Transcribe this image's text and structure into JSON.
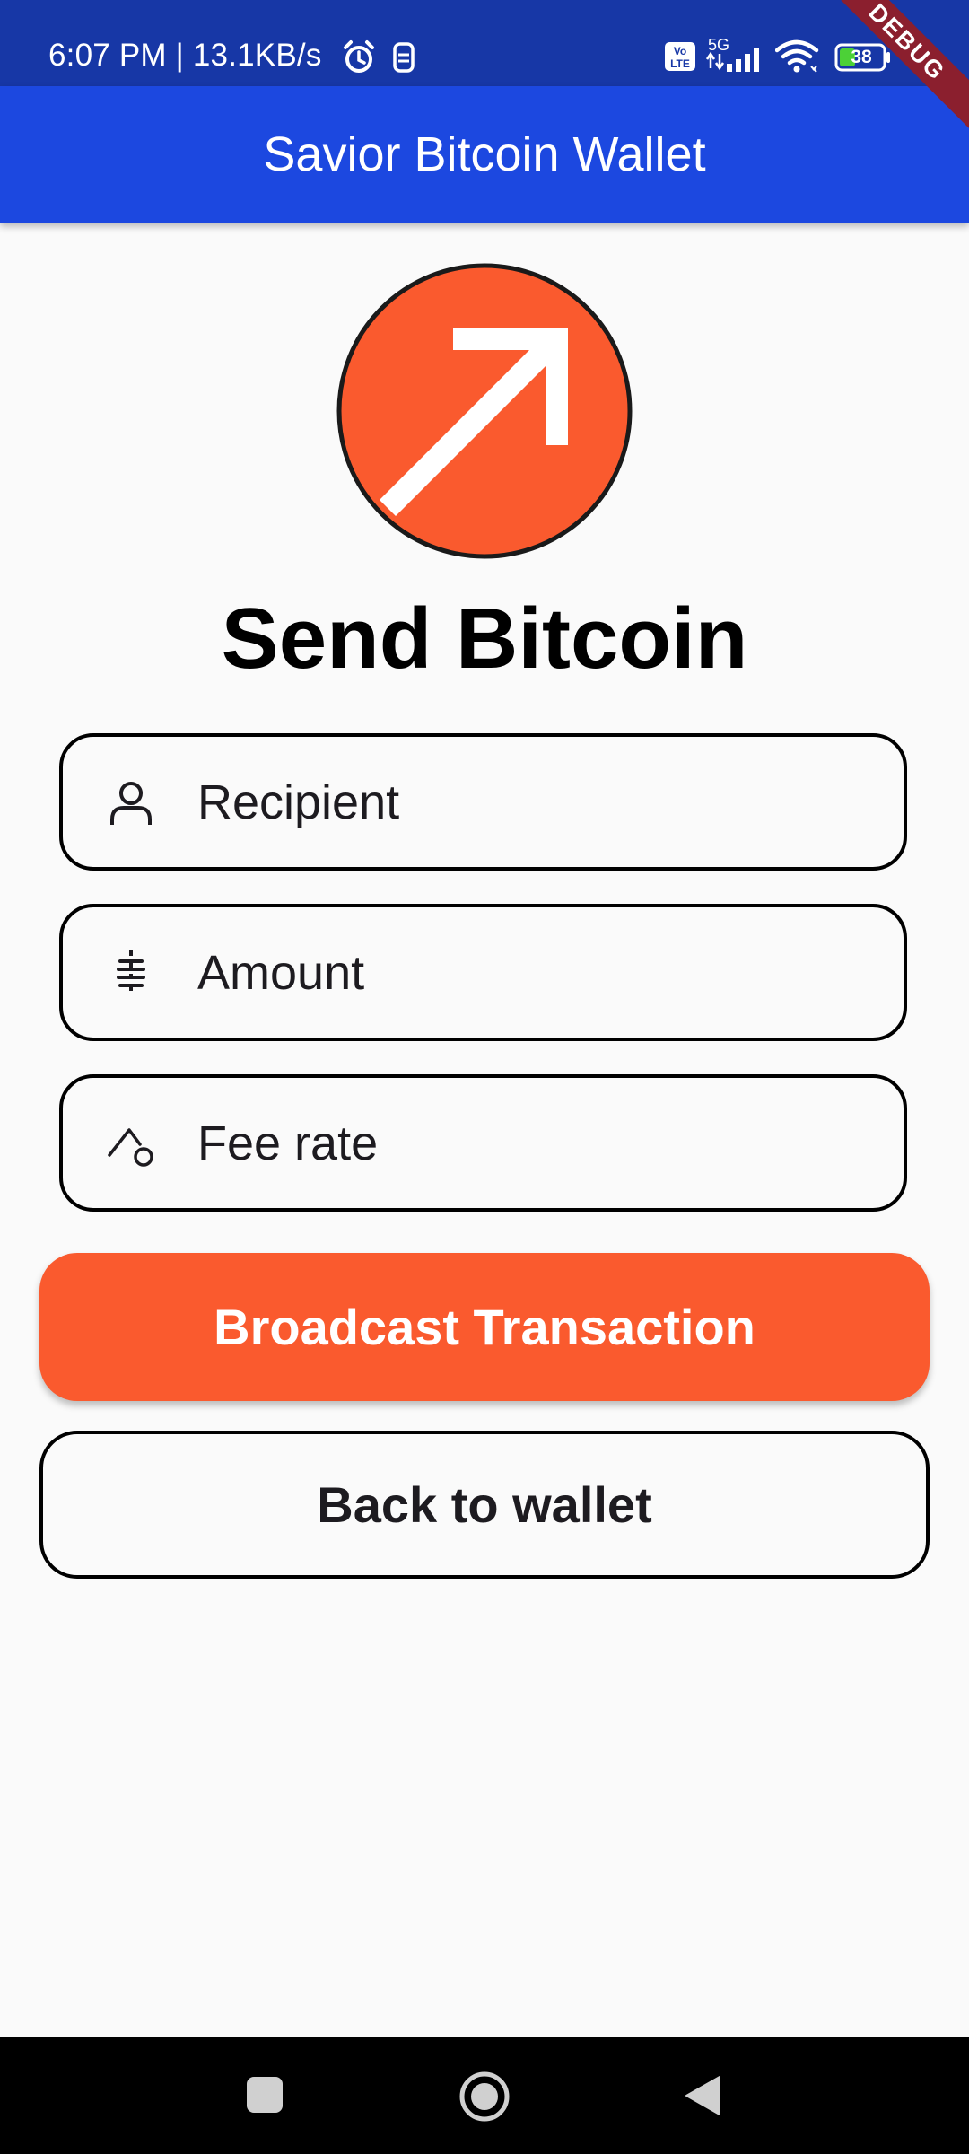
{
  "status_bar": {
    "time_speed": "6:07 PM | 13.1KB/s",
    "network_small": "5G",
    "volte_label": "Vo LTE",
    "battery_level": "38",
    "icons": [
      "alarm-icon",
      "notification-icon",
      "volte-icon",
      "signal-icon",
      "wifi-icon",
      "battery-icon"
    ]
  },
  "debug_banner": "DEBUG",
  "app_bar": {
    "title": "Savior Bitcoin Wallet"
  },
  "main": {
    "title": "Send Bitcoin",
    "logo_icon": "arrow-up-right-icon",
    "fields": {
      "recipient": {
        "placeholder": "Recipient",
        "value": "",
        "icon": "person-icon"
      },
      "amount": {
        "placeholder": "Amount",
        "value": "",
        "icon": "bitcoin-icon"
      },
      "fee_rate": {
        "placeholder": "Fee rate",
        "value": "",
        "icon": "pickaxe-icon"
      }
    },
    "broadcast_button": "Broadcast Transaction",
    "back_button": "Back to wallet"
  },
  "nav_bar": {
    "items": [
      "recent-apps",
      "home",
      "back"
    ]
  },
  "colors": {
    "status_bar": "#1737a6",
    "app_bar": "#1c48e0",
    "accent": "#fa5a2e",
    "background": "#fafafa"
  }
}
